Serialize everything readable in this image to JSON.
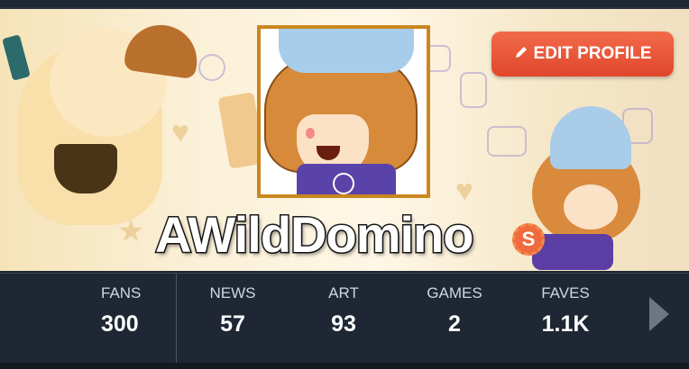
{
  "profile": {
    "username": "AWildDomino",
    "supporter_badge": "S",
    "edit_button_label": "EDIT PROFILE"
  },
  "icons": {
    "edit": "pencil-icon",
    "next": "chevron-right-icon",
    "supporter": "supporter-badge-icon"
  },
  "colors": {
    "edit_button": "#e0472c",
    "avatar_border": "#c9871e",
    "stats_bar": "#1e2733",
    "supporter": "#ef6b3d"
  },
  "stats": [
    {
      "label": "FANS",
      "value": "300"
    },
    {
      "label": "NEWS",
      "value": "57"
    },
    {
      "label": "ART",
      "value": "93"
    },
    {
      "label": "GAMES",
      "value": "2"
    },
    {
      "label": "FAVES",
      "value": "1.1K"
    }
  ]
}
